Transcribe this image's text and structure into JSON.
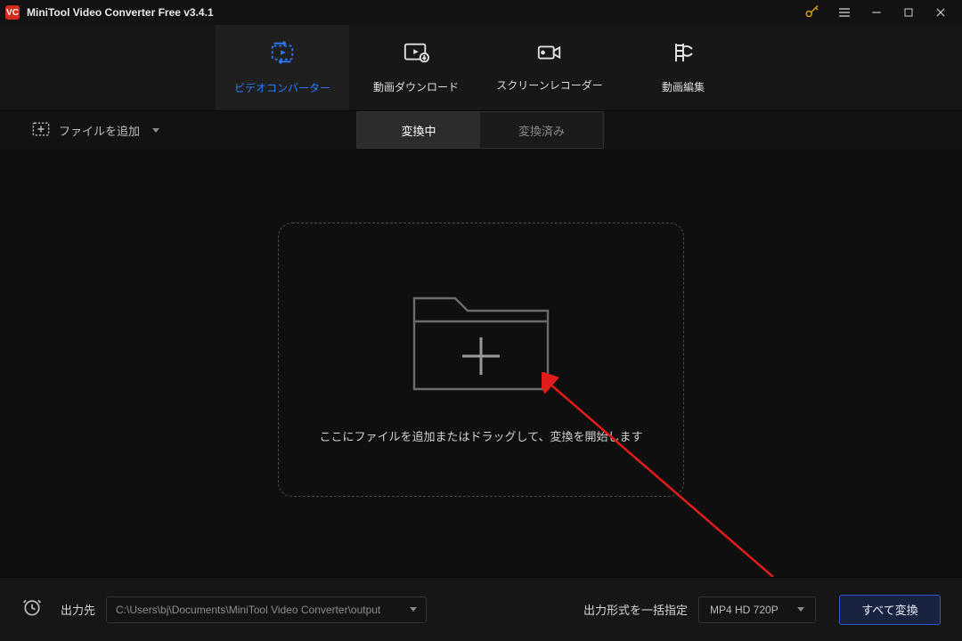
{
  "titlebar": {
    "logo_text": "VC",
    "title": "MiniTool Video Converter Free v3.4.1"
  },
  "tabs": [
    {
      "id": "converter",
      "label": "ビデオコンバーター",
      "active": true
    },
    {
      "id": "download",
      "label": "動画ダウンロード",
      "active": false
    },
    {
      "id": "recorder",
      "label": "スクリーンレコーダー",
      "active": false
    },
    {
      "id": "editor",
      "label": "動画編集",
      "active": false
    }
  ],
  "toolbar": {
    "add_files_label": "ファイルを追加",
    "segment": {
      "active_label": "変換中",
      "inactive_label": "変換済み"
    }
  },
  "dropzone": {
    "hint": "ここにファイルを追加またはドラッグして、変換を開始します"
  },
  "bottombar": {
    "output_label": "出力先",
    "output_path": "C:\\Users\\bj\\Documents\\MiniTool Video Converter\\output",
    "format_label": "出力形式を一括指定",
    "format_value": "MP4 HD 720P",
    "convert_label": "すべて変換"
  }
}
